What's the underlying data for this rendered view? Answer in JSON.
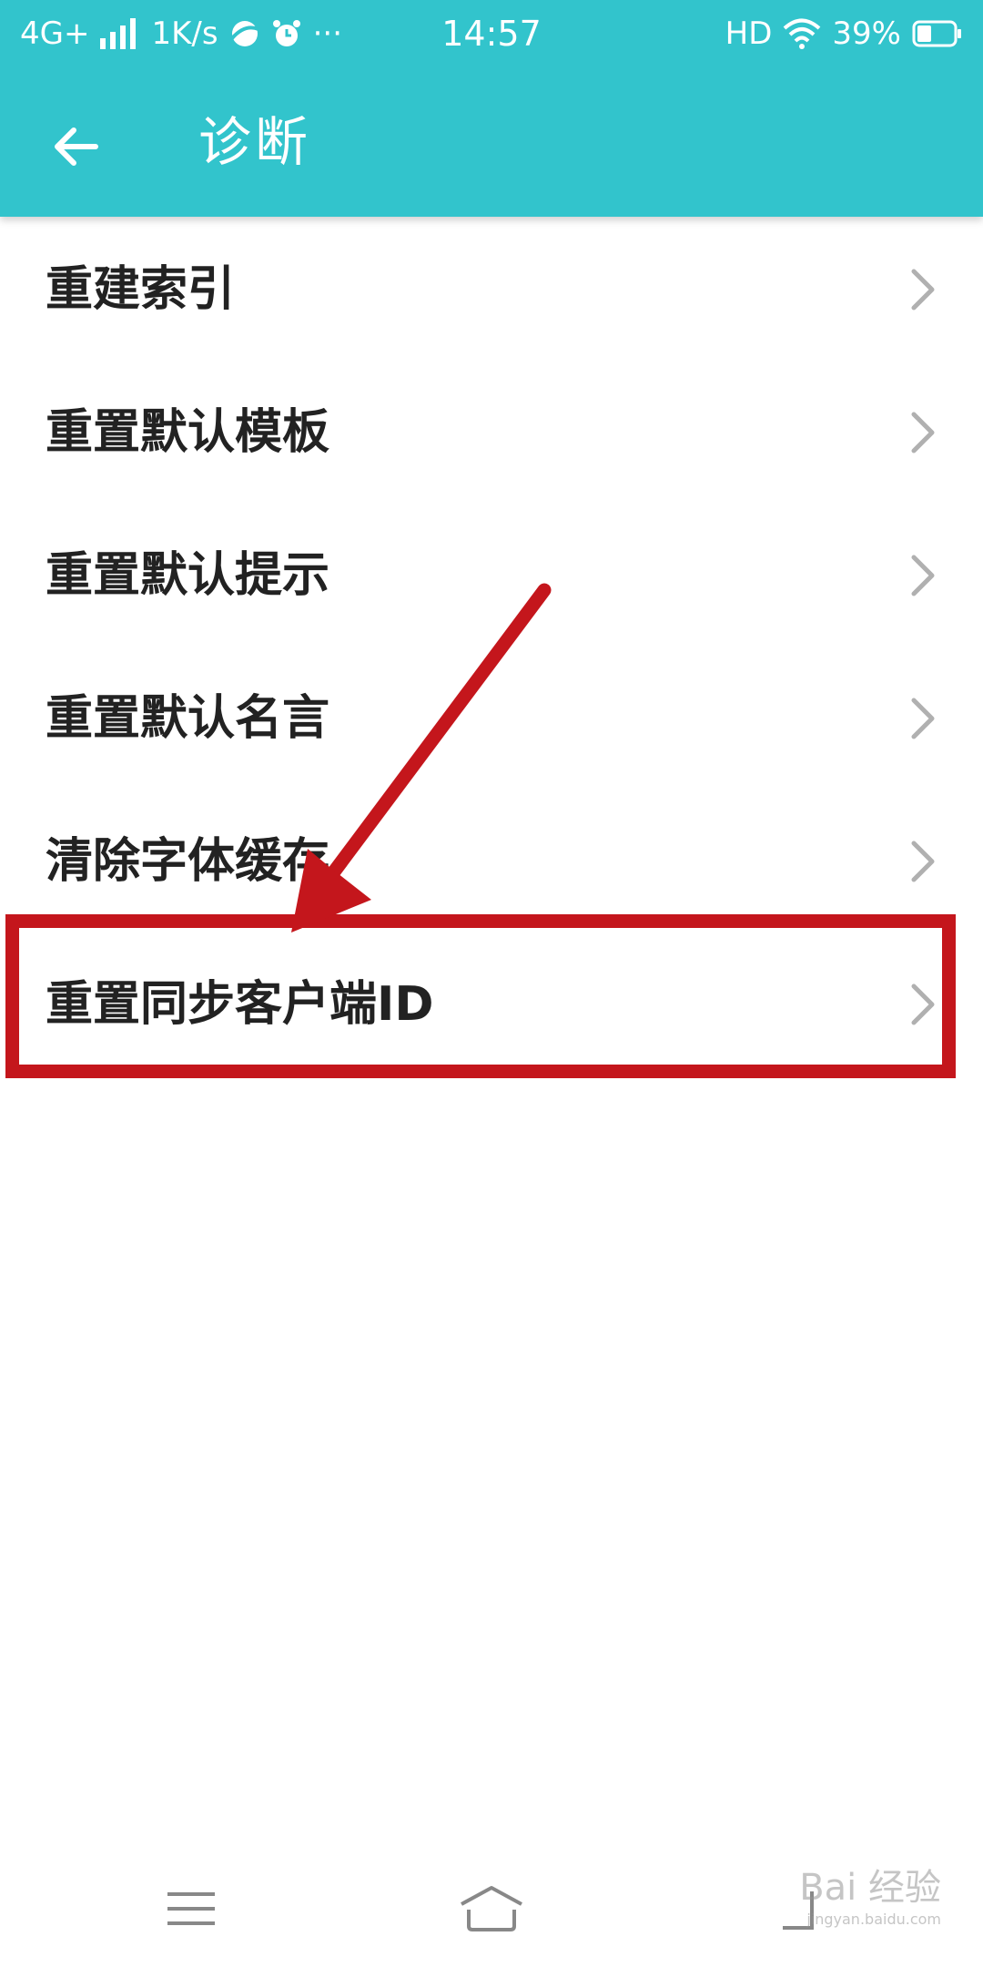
{
  "status_bar": {
    "network": "4G+",
    "speed": "1K/s",
    "more": "···",
    "time": "14:57",
    "hd": "HD",
    "battery": "39%"
  },
  "app_bar": {
    "title": "诊断",
    "back_icon": "arrow-left-icon"
  },
  "menu": {
    "items": [
      {
        "label": "重建索引"
      },
      {
        "label": "重置默认模板"
      },
      {
        "label": "重置默认提示"
      },
      {
        "label": "重置默认名言"
      },
      {
        "label": "清除字体缓存"
      },
      {
        "label": "重置同步客户端ID"
      }
    ]
  },
  "annotation": {
    "highlight_color": "#c4161c",
    "highlighted_item": "重置同步客户端ID"
  },
  "nav_bar": {
    "menu_icon": "menu-icon",
    "home_icon": "home-icon",
    "back_icon": "back-icon"
  },
  "watermark": {
    "text": "Bai 经验",
    "url": "jingyan.baidu.com"
  },
  "colors": {
    "primary": "#32c4cc",
    "text": "#222222",
    "chevron": "#b0b0b0"
  }
}
